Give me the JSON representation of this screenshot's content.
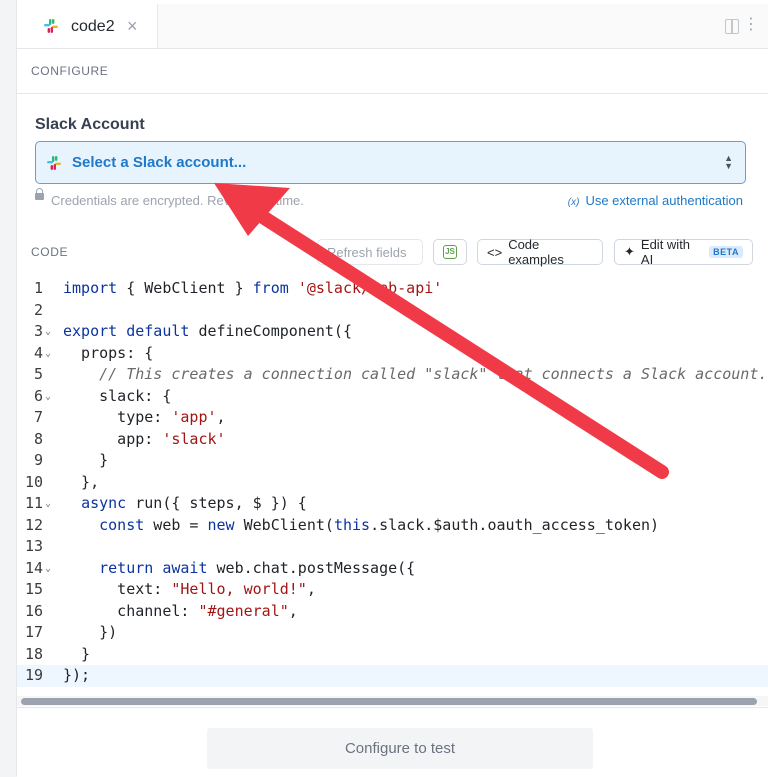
{
  "tab": {
    "title": "code2",
    "close": "×"
  },
  "sections": {
    "configure": "CONFIGURE",
    "code": "CODE"
  },
  "slack_account": {
    "label": "Slack Account",
    "select_text": "Select a Slack account...",
    "credentials_note": "Credentials are encrypted. Revoke anytime.",
    "external_auth": "Use external authentication",
    "external_auth_icon": "(x)"
  },
  "toolbar": {
    "refresh_fields": "Refresh fields",
    "code_examples": "Code examples",
    "edit_ai": "Edit with AI",
    "beta": "BETA"
  },
  "code_lines": [
    "import { WebClient } from '@slack/web-api'",
    "",
    "export default defineComponent({",
    "  props: {",
    "    // This creates a connection called \"slack\" that connects a Slack account.",
    "    slack: {",
    "      type: 'app',",
    "      app: 'slack'",
    "    }",
    "  },",
    "  async run({ steps, $ }) {",
    "    const web = new WebClient(this.slack.$auth.oauth_access_token)",
    "",
    "    return await web.chat.postMessage({",
    "      text: \"Hello, world!\",",
    "      channel: \"#general\",",
    "    })",
    "  }",
    "});"
  ],
  "footer": {
    "test_button": "Configure to test"
  },
  "colors": {
    "accent": "#1f78c8",
    "arrow": "#f03a47",
    "select_bg": "#e8f4fd"
  }
}
